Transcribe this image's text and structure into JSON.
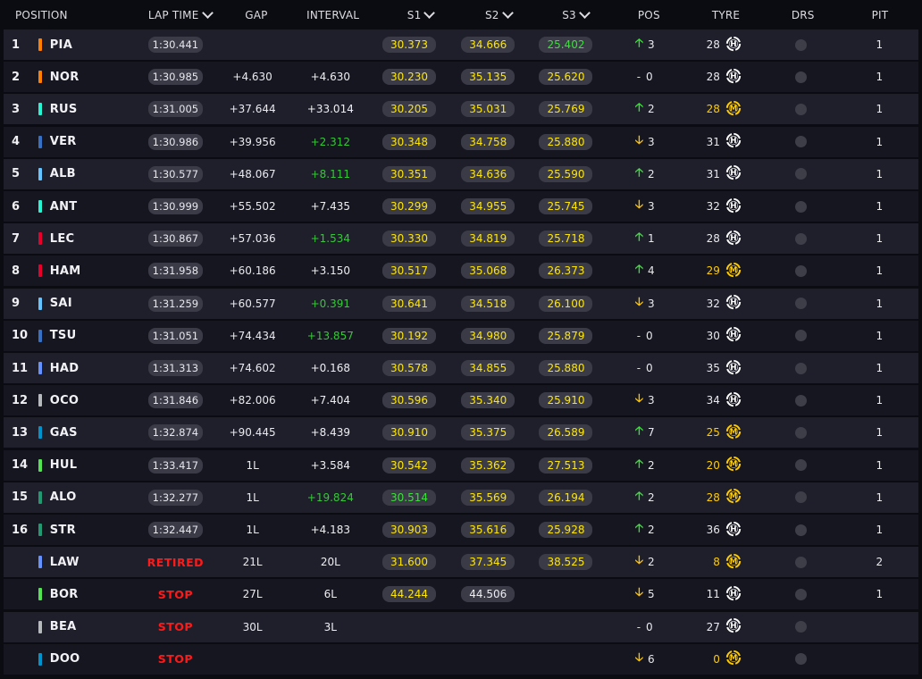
{
  "header": {
    "position": "POSITION",
    "lap_time": "LAP TIME",
    "gap": "GAP",
    "interval": "INTERVAL",
    "s1": "S1",
    "s2": "S2",
    "s3": "S3",
    "pos": "POS",
    "tyre": "TYRE",
    "drs": "DRS",
    "pit": "PIT"
  },
  "colors": {
    "mclaren": "#ff8000",
    "mercedes": "#27f4d2",
    "redbull": "#3671c6",
    "williams": "#64c4ff",
    "ferrari": "#e8002d",
    "rb": "#6692ff",
    "alpine": "#c7c7c7",
    "aston": "#229971",
    "sauber": "#52e252",
    "haas": "#b6babd",
    "alpine_doo": "#0093cc",
    "sector_yellow": "#ffe600",
    "sector_green": "#3ce03a",
    "status_red": "#ff1a1a"
  },
  "rows": [
    {
      "pos": "1",
      "driver": "PIA",
      "team_color": "#ff8000",
      "lap_time": "1:30.441",
      "lap_status": "",
      "gap": "",
      "interval": "",
      "interval_color": "white",
      "s1": "30.373",
      "s1c": "yellow",
      "s2": "34.666",
      "s2c": "yellow",
      "s3": "25.402",
      "s3c": "green",
      "pos_dir": "up",
      "pos_change": "3",
      "tyre_laps": "28",
      "tyre": "H",
      "drs": "off",
      "pit": "1"
    },
    {
      "pos": "2",
      "driver": "NOR",
      "team_color": "#ff8000",
      "lap_time": "1:30.985",
      "lap_status": "",
      "gap": "+4.630",
      "interval": "+4.630",
      "interval_color": "white",
      "s1": "30.230",
      "s1c": "yellow",
      "s2": "35.135",
      "s2c": "yellow",
      "s3": "25.620",
      "s3c": "yellow",
      "pos_dir": "same",
      "pos_change": "0",
      "tyre_laps": "28",
      "tyre": "H",
      "drs": "off",
      "pit": "1"
    },
    {
      "pos": "3",
      "driver": "RUS",
      "team_color": "#27f4d2",
      "lap_time": "1:31.005",
      "lap_status": "",
      "gap": "+37.644",
      "interval": "+33.014",
      "interval_color": "white",
      "s1": "30.205",
      "s1c": "yellow",
      "s2": "35.031",
      "s2c": "yellow",
      "s3": "25.769",
      "s3c": "yellow",
      "pos_dir": "up",
      "pos_change": "2",
      "tyre_laps": "28",
      "tyre": "M",
      "drs": "off",
      "pit": "1"
    },
    {
      "pos": "4",
      "driver": "VER",
      "team_color": "#3671c6",
      "lap_time": "1:30.986",
      "lap_status": "",
      "gap": "+39.956",
      "interval": "+2.312",
      "interval_color": "green",
      "s1": "30.348",
      "s1c": "yellow",
      "s2": "34.758",
      "s2c": "yellow",
      "s3": "25.880",
      "s3c": "yellow",
      "pos_dir": "down",
      "pos_change": "3",
      "tyre_laps": "31",
      "tyre": "H",
      "drs": "off",
      "pit": "1"
    },
    {
      "pos": "5",
      "driver": "ALB",
      "team_color": "#64c4ff",
      "lap_time": "1:30.577",
      "lap_status": "",
      "gap": "+48.067",
      "interval": "+8.111",
      "interval_color": "green",
      "s1": "30.351",
      "s1c": "yellow",
      "s2": "34.636",
      "s2c": "yellow",
      "s3": "25.590",
      "s3c": "yellow",
      "pos_dir": "up",
      "pos_change": "2",
      "tyre_laps": "31",
      "tyre": "H",
      "drs": "off",
      "pit": "1"
    },
    {
      "pos": "6",
      "driver": "ANT",
      "team_color": "#27f4d2",
      "lap_time": "1:30.999",
      "lap_status": "",
      "gap": "+55.502",
      "interval": "+7.435",
      "interval_color": "white",
      "s1": "30.299",
      "s1c": "yellow",
      "s2": "34.955",
      "s2c": "yellow",
      "s3": "25.745",
      "s3c": "yellow",
      "pos_dir": "down",
      "pos_change": "3",
      "tyre_laps": "32",
      "tyre": "H",
      "drs": "off",
      "pit": "1"
    },
    {
      "pos": "7",
      "driver": "LEC",
      "team_color": "#e8002d",
      "lap_time": "1:30.867",
      "lap_status": "",
      "gap": "+57.036",
      "interval": "+1.534",
      "interval_color": "green",
      "s1": "30.330",
      "s1c": "yellow",
      "s2": "34.819",
      "s2c": "yellow",
      "s3": "25.718",
      "s3c": "yellow",
      "pos_dir": "up",
      "pos_change": "1",
      "tyre_laps": "28",
      "tyre": "H",
      "drs": "off",
      "pit": "1"
    },
    {
      "pos": "8",
      "driver": "HAM",
      "team_color": "#e8002d",
      "lap_time": "1:31.958",
      "lap_status": "",
      "gap": "+60.186",
      "interval": "+3.150",
      "interval_color": "white",
      "s1": "30.517",
      "s1c": "yellow",
      "s2": "35.068",
      "s2c": "yellow",
      "s3": "26.373",
      "s3c": "yellow",
      "pos_dir": "up",
      "pos_change": "4",
      "tyre_laps": "29",
      "tyre": "M",
      "drs": "off",
      "pit": "1"
    },
    {
      "pos": "9",
      "driver": "SAI",
      "team_color": "#64c4ff",
      "lap_time": "1:31.259",
      "lap_status": "",
      "gap": "+60.577",
      "interval": "+0.391",
      "interval_color": "green",
      "s1": "30.641",
      "s1c": "yellow",
      "s2": "34.518",
      "s2c": "yellow",
      "s3": "26.100",
      "s3c": "yellow",
      "pos_dir": "down",
      "pos_change": "3",
      "tyre_laps": "32",
      "tyre": "H",
      "drs": "off",
      "pit": "1"
    },
    {
      "pos": "10",
      "driver": "TSU",
      "team_color": "#3671c6",
      "lap_time": "1:31.051",
      "lap_status": "",
      "gap": "+74.434",
      "interval": "+13.857",
      "interval_color": "green",
      "s1": "30.192",
      "s1c": "yellow",
      "s2": "34.980",
      "s2c": "yellow",
      "s3": "25.879",
      "s3c": "yellow",
      "pos_dir": "same",
      "pos_change": "0",
      "tyre_laps": "30",
      "tyre": "H",
      "drs": "off",
      "pit": "1"
    },
    {
      "pos": "11",
      "driver": "HAD",
      "team_color": "#6692ff",
      "lap_time": "1:31.313",
      "lap_status": "",
      "gap": "+74.602",
      "interval": "+0.168",
      "interval_color": "white",
      "s1": "30.578",
      "s1c": "yellow",
      "s2": "34.855",
      "s2c": "yellow",
      "s3": "25.880",
      "s3c": "yellow",
      "pos_dir": "same",
      "pos_change": "0",
      "tyre_laps": "35",
      "tyre": "H",
      "drs": "off",
      "pit": "1"
    },
    {
      "pos": "12",
      "driver": "OCO",
      "team_color": "#b6babd",
      "lap_time": "1:31.846",
      "lap_status": "",
      "gap": "+82.006",
      "interval": "+7.404",
      "interval_color": "white",
      "s1": "30.596",
      "s1c": "yellow",
      "s2": "35.340",
      "s2c": "yellow",
      "s3": "25.910",
      "s3c": "yellow",
      "pos_dir": "down",
      "pos_change": "3",
      "tyre_laps": "34",
      "tyre": "H",
      "drs": "off",
      "pit": "1"
    },
    {
      "pos": "13",
      "driver": "GAS",
      "team_color": "#0093cc",
      "lap_time": "1:32.874",
      "lap_status": "",
      "gap": "+90.445",
      "interval": "+8.439",
      "interval_color": "white",
      "s1": "30.910",
      "s1c": "yellow",
      "s2": "35.375",
      "s2c": "yellow",
      "s3": "26.589",
      "s3c": "yellow",
      "pos_dir": "up",
      "pos_change": "7",
      "tyre_laps": "25",
      "tyre": "M",
      "drs": "off",
      "pit": "1"
    },
    {
      "pos": "14",
      "driver": "HUL",
      "team_color": "#52e252",
      "lap_time": "1:33.417",
      "lap_status": "",
      "gap": "1L",
      "interval": "+3.584",
      "interval_color": "white",
      "s1": "30.542",
      "s1c": "yellow",
      "s2": "35.362",
      "s2c": "yellow",
      "s3": "27.513",
      "s3c": "yellow",
      "pos_dir": "up",
      "pos_change": "2",
      "tyre_laps": "20",
      "tyre": "M",
      "drs": "off",
      "pit": "1"
    },
    {
      "pos": "15",
      "driver": "ALO",
      "team_color": "#229971",
      "lap_time": "1:32.277",
      "lap_status": "",
      "gap": "1L",
      "interval": "+19.824",
      "interval_color": "green",
      "s1": "30.514",
      "s1c": "green",
      "s2": "35.569",
      "s2c": "yellow",
      "s3": "26.194",
      "s3c": "yellow",
      "pos_dir": "up",
      "pos_change": "2",
      "tyre_laps": "28",
      "tyre": "M",
      "drs": "off",
      "pit": "1"
    },
    {
      "pos": "16",
      "driver": "STR",
      "team_color": "#229971",
      "lap_time": "1:32.447",
      "lap_status": "",
      "gap": "1L",
      "interval": "+4.183",
      "interval_color": "white",
      "s1": "30.903",
      "s1c": "yellow",
      "s2": "35.616",
      "s2c": "yellow",
      "s3": "25.928",
      "s3c": "yellow",
      "pos_dir": "up",
      "pos_change": "2",
      "tyre_laps": "36",
      "tyre": "H",
      "drs": "off",
      "pit": "1"
    },
    {
      "pos": "",
      "driver": "LAW",
      "team_color": "#6692ff",
      "lap_time": "",
      "lap_status": "RETIRED",
      "gap": "21L",
      "interval": "20L",
      "interval_color": "white",
      "s1": "31.600",
      "s1c": "yellow",
      "s2": "37.345",
      "s2c": "yellow",
      "s3": "38.525",
      "s3c": "yellow",
      "pos_dir": "down",
      "pos_change": "2",
      "tyre_laps": "8",
      "tyre": "M",
      "drs": "off",
      "pit": "2"
    },
    {
      "pos": "",
      "driver": "BOR",
      "team_color": "#52e252",
      "lap_time": "",
      "lap_status": "STOP",
      "gap": "27L",
      "interval": "6L",
      "interval_color": "white",
      "s1": "44.244",
      "s1c": "yellow",
      "s2": "44.506",
      "s2c": "white",
      "s3": "",
      "s3c": "yellow",
      "pos_dir": "down",
      "pos_change": "5",
      "tyre_laps": "11",
      "tyre": "H",
      "drs": "off",
      "pit": "1"
    },
    {
      "pos": "",
      "driver": "BEA",
      "team_color": "#b6babd",
      "lap_time": "",
      "lap_status": "STOP",
      "gap": "30L",
      "interval": "3L",
      "interval_color": "white",
      "s1": "",
      "s1c": "yellow",
      "s2": "",
      "s2c": "yellow",
      "s3": "",
      "s3c": "yellow",
      "pos_dir": "same",
      "pos_change": "0",
      "tyre_laps": "27",
      "tyre": "H",
      "drs": "off",
      "pit": ""
    },
    {
      "pos": "",
      "driver": "DOO",
      "team_color": "#0093cc",
      "lap_time": "",
      "lap_status": "STOP",
      "gap": "",
      "interval": "",
      "interval_color": "white",
      "s1": "",
      "s1c": "yellow",
      "s2": "",
      "s2c": "yellow",
      "s3": "",
      "s3c": "yellow",
      "pos_dir": "down",
      "pos_change": "6",
      "tyre_laps": "0",
      "tyre": "M",
      "drs": "off",
      "pit": ""
    }
  ]
}
